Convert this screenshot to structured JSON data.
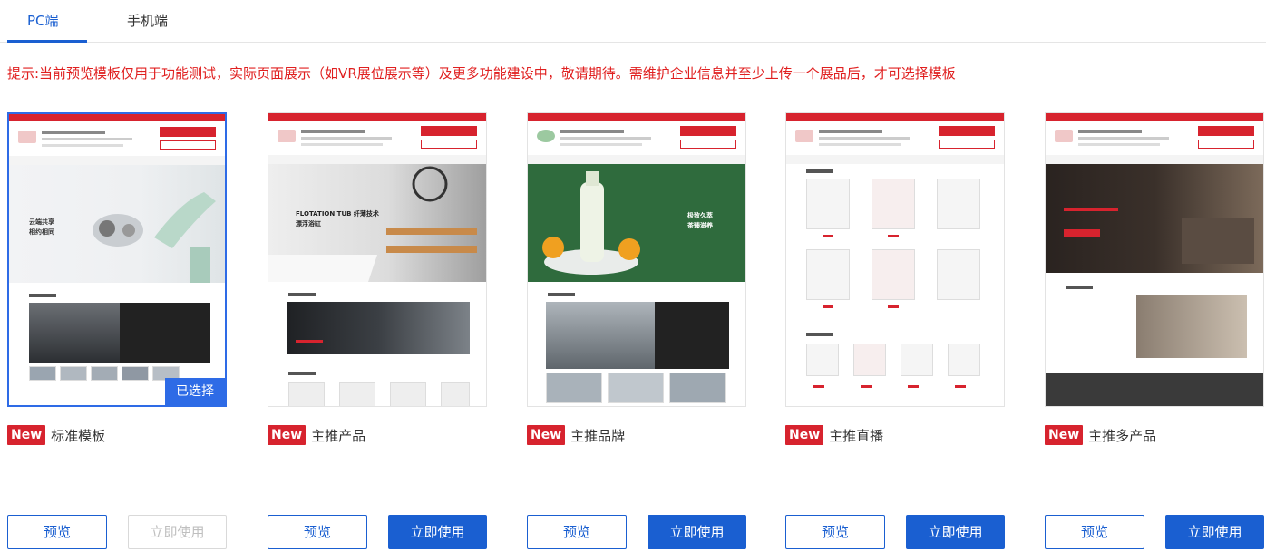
{
  "tabs": [
    {
      "label": "PC端",
      "active": true
    },
    {
      "label": "手机端",
      "active": false
    }
  ],
  "notice": "提示:当前预览模板仅用于功能测试，实际页面展示（如VR展位展示等）及更多功能建设中，敬请期待。需维护企业信息并至少上传一个展品后，才可选择模板",
  "colors": {
    "accent": "#1a5fd1",
    "brand_red": "#d7232e",
    "notice_red": "#e02020"
  },
  "selected_badge": "已选择",
  "new_badge": "New",
  "templates": [
    {
      "title": "标准模板",
      "hero_text": "云端共享\n相约相同",
      "preview_label": "预览",
      "use_label": "立即使用",
      "selected": true,
      "use_disabled": true
    },
    {
      "title": "主推产品",
      "hero_text": "FLOTATION TUB 纤薄技术\n漂浮浴缸",
      "preview_label": "预览",
      "use_label": "立即使用",
      "selected": false,
      "use_disabled": false
    },
    {
      "title": "主推品牌",
      "hero_text": "极致久萃\n茶臻滋养",
      "preview_label": "预览",
      "use_label": "立即使用",
      "selected": false,
      "use_disabled": false
    },
    {
      "title": "主推直播",
      "hero_text": "",
      "preview_label": "预览",
      "use_label": "立即使用",
      "selected": false,
      "use_disabled": false
    },
    {
      "title": "主推多产品",
      "hero_text": "",
      "preview_label": "预览",
      "use_label": "立即使用",
      "selected": false,
      "use_disabled": false
    }
  ]
}
